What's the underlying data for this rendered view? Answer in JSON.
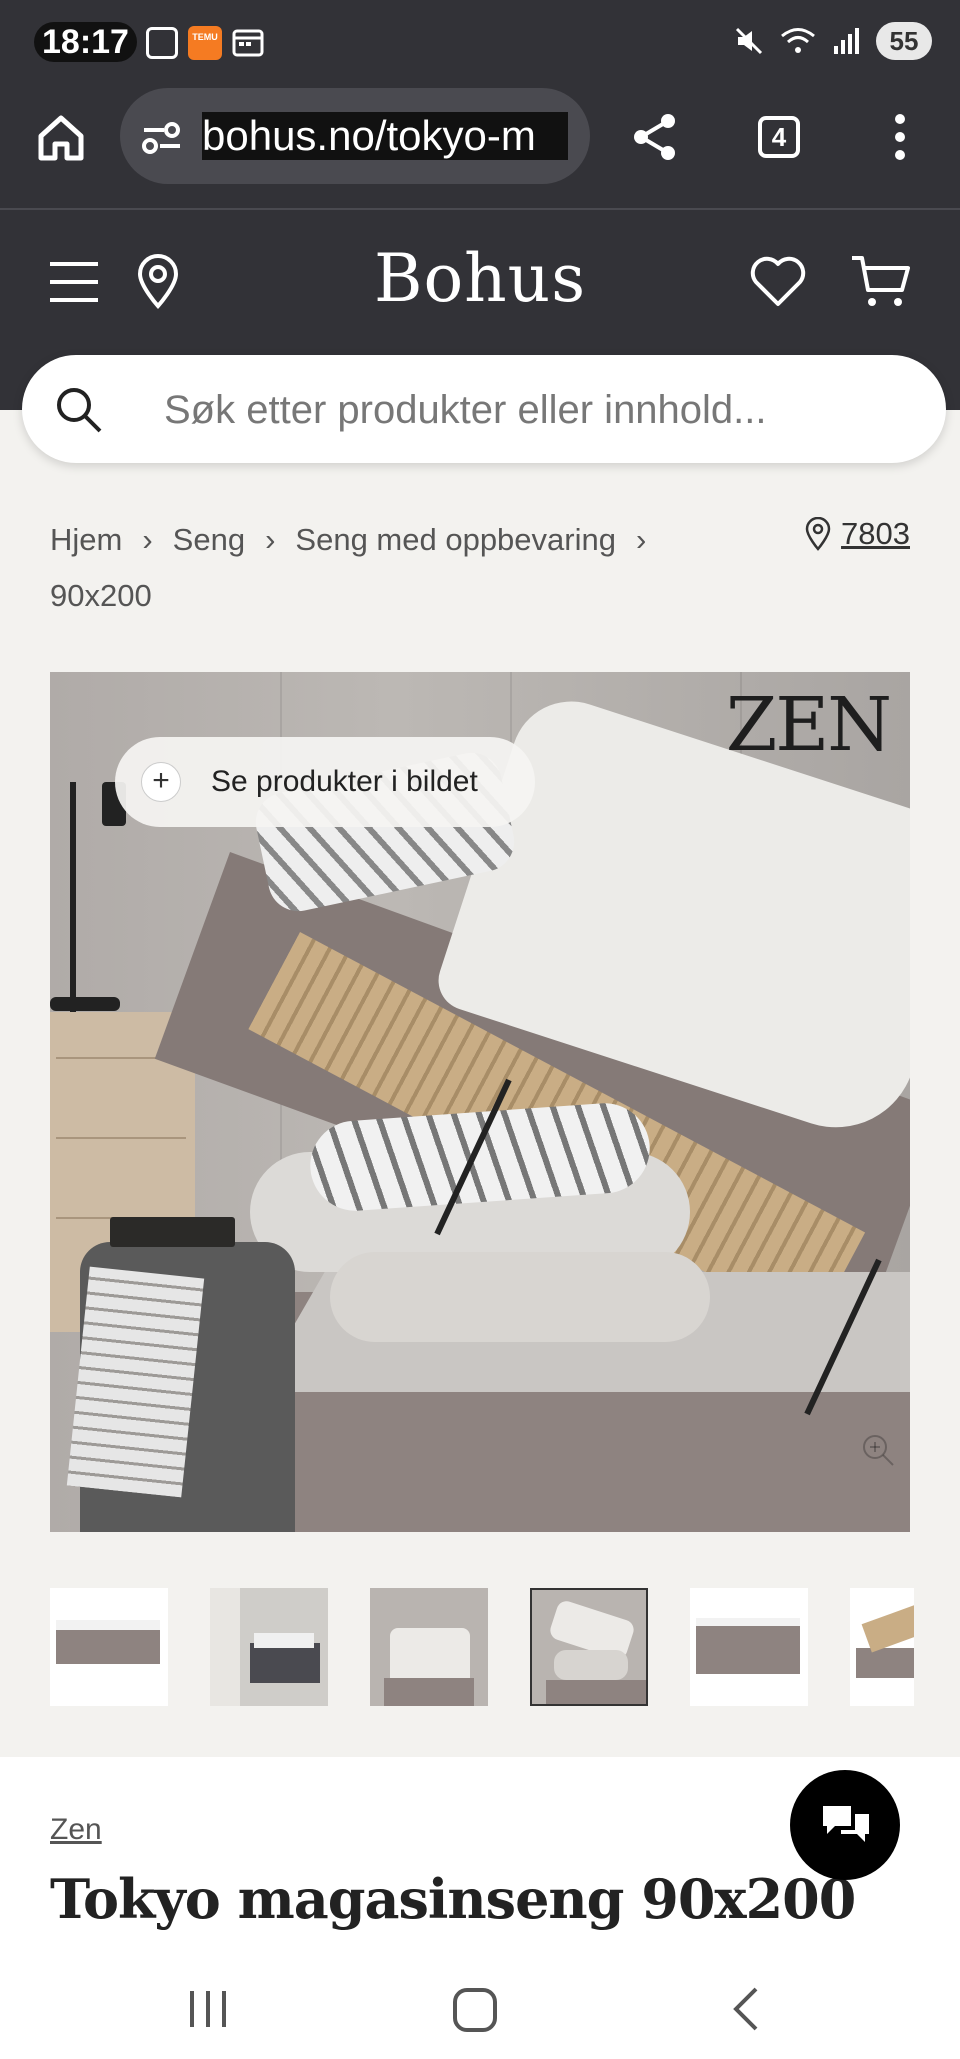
{
  "status_bar": {
    "time": "18:17",
    "notification_badge": "TEMU",
    "battery": "55"
  },
  "browser": {
    "url": "bohus.no/tokyo-m",
    "tab_count": "4"
  },
  "site": {
    "logo": "Bohus",
    "search_placeholder": "Søk etter produkter eller innhold..."
  },
  "breadcrumb": {
    "items": [
      "Hjem",
      "Seng",
      "Seng med oppbevaring"
    ],
    "last": "90x200",
    "store_code": "7803"
  },
  "hero": {
    "watermark": "ZEN",
    "see_products_label": "Se produkter i bildet"
  },
  "product": {
    "brand": "Zen",
    "title": "Tokyo magasinseng 90x200"
  },
  "colors": {
    "header_bg": "#323237",
    "page_bg": "#f3f2ef"
  }
}
